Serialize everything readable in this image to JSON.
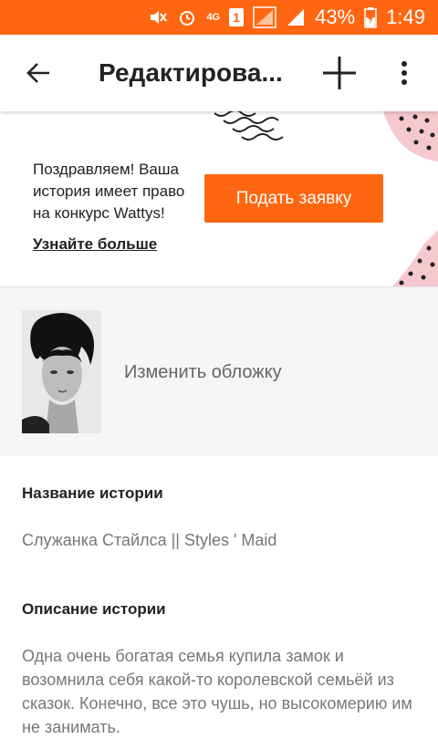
{
  "status_bar": {
    "network_label": "4G",
    "sim_badge": "1",
    "battery": "43%",
    "time": "1:49"
  },
  "app_bar": {
    "title": "Редактирова..."
  },
  "banner": {
    "message": "Поздравляем! Ваша история имеет право на конкурс Wattys!",
    "link": "Узнайте больше",
    "button": "Подать заявку"
  },
  "cover": {
    "label": "Изменить обложку"
  },
  "story": {
    "title_label": "Название истории",
    "title_value": "Служанка Стайлса || Styles ' Maid",
    "description_label": "Описание истории",
    "description_value": "Одна очень богатая семья купила замок и возомнила себя какой-то королевской семьёй из сказок. Конечно, все это чушь, но высокомерию им не занимать."
  },
  "colors": {
    "accent": "#ff6611",
    "pink_decor": "#f6c9cf"
  }
}
